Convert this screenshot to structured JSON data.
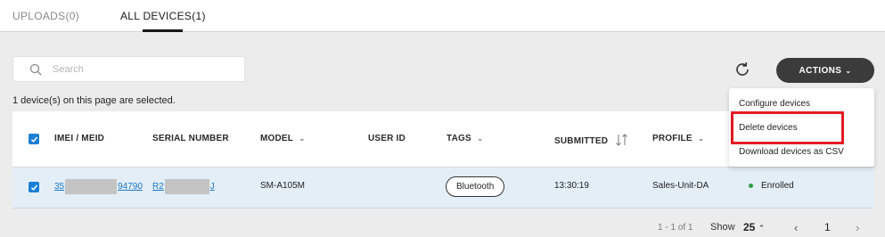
{
  "tabs": [
    {
      "label": "UPLOADS(0)"
    },
    {
      "label": "ALL DEVICES(1)"
    }
  ],
  "search": {
    "placeholder": "Search"
  },
  "actions": {
    "label": "ACTIONS",
    "icon": "chevron-down-icon"
  },
  "selection_text": "1 device(s) on this page are selected.",
  "dropdown": {
    "items": [
      {
        "label": "Configure devices"
      },
      {
        "label": "Delete devices"
      },
      {
        "label": "Download devices as CSV"
      }
    ]
  },
  "table": {
    "headers": {
      "imei": "IMEI / MEID",
      "serial": "SERIAL NUMBER",
      "model": "MODEL",
      "user_id": "USER ID",
      "tags": "TAGS",
      "submitted": "SUBMITTED",
      "profile": "PROFILE"
    },
    "rows": [
      {
        "imei_prefix": "35",
        "imei_suffix": "94790",
        "serial_prefix": "R2",
        "serial_suffix": "J",
        "model": "SM-A105M",
        "user_id": "",
        "tag": "Bluetooth",
        "submitted": "13:30:19",
        "profile": "Sales-Unit-DA",
        "status": "Enrolled"
      }
    ]
  },
  "pagination": {
    "range": "1 - 1 of 1",
    "show_label": "Show",
    "page_size": "25",
    "current_page": "1"
  },
  "colors": {
    "accent": "#1c7fd6",
    "link": "#1b78c8",
    "selected_row": "#e3eef7",
    "highlight": "#e31b23",
    "status_enrolled": "#2e9e47"
  }
}
